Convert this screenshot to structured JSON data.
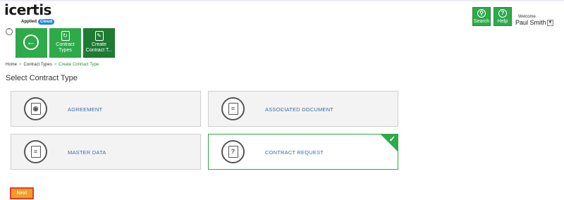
{
  "brand": {
    "name": "icertis",
    "sub": "Applied",
    "cloud_badge": "Cloud"
  },
  "header": {
    "search_label": "Search",
    "help_label": "Help",
    "welcome": "Welcome",
    "user_name": "Paul Smith"
  },
  "toolbar": {
    "contract_types_label": "Contract Types",
    "create_contract_label": "Create Contract T..."
  },
  "breadcrumb": {
    "home": "Home",
    "contract_types": "Contract Types",
    "current": "Create Contract Type",
    "separator": ">"
  },
  "page": {
    "title": "Select Contract Type"
  },
  "cards": [
    {
      "label": "AGREEMENT",
      "icon": "certificate-icon"
    },
    {
      "label": "ASSOCIATED DOCUMENT",
      "icon": "documents-icon"
    },
    {
      "label": "MASTER DATA",
      "icon": "stacked-documents-icon"
    },
    {
      "label": "CONTRACT REQUEST",
      "icon": "clipboard-question-icon",
      "selected": true
    }
  ],
  "actions": {
    "next_label": "Next"
  },
  "colors": {
    "accent": "#2eaa4a",
    "dark_accent": "#1f7a34",
    "link": "#3a6fa8",
    "next_button": "#f0a020",
    "highlight": "#e53935"
  }
}
